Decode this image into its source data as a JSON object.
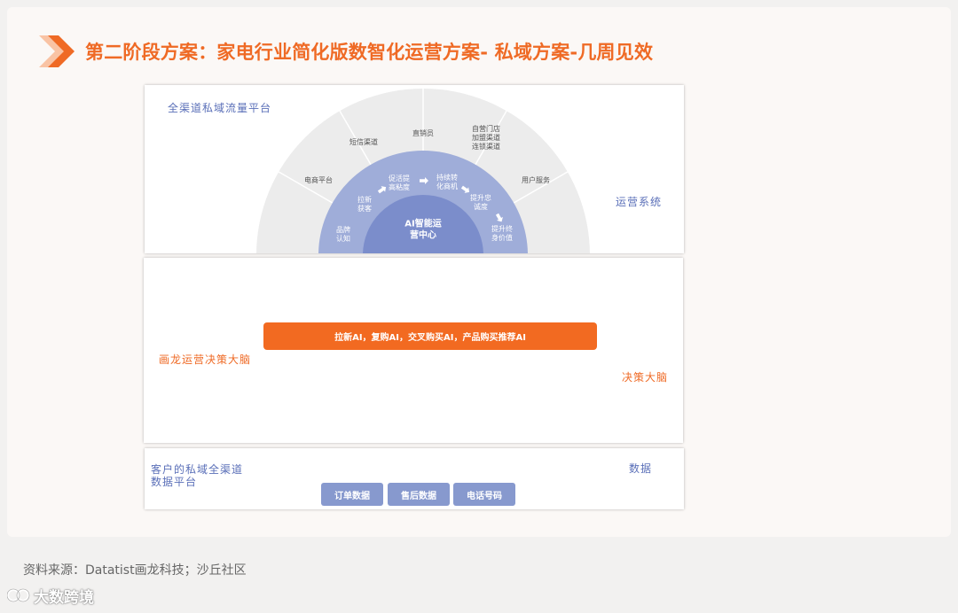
{
  "page": {
    "title": "第二阶段方案：家电行业简化版数智化运营方案- 私域方案-几周见效",
    "source": "资料来源：Datatist画龙科技；沙丘社区",
    "watermark": "大数跨境"
  },
  "top_panel": {
    "left_label": "全渠道私域流量平台",
    "right_label": "运营系统",
    "outer_segments": [
      "电商平台",
      "短信渠道",
      "直销员",
      "自营门店\n加盟渠道\n连锁渠道",
      "用户服务"
    ],
    "inner_steps": [
      "品牌\n认知",
      "拉新\n获客",
      "促活提\n高粘度",
      "持续转\n化商机",
      "提升忠\n诚度",
      "提升终\n身价值"
    ],
    "center": "AI智能运\n营中心"
  },
  "middle_panel": {
    "left_label": "画龙运营决策大脑",
    "right_label": "决策大脑",
    "bar_text": "拉新AI，复购AI，交叉购买AI，产品购买推荐AI"
  },
  "bottom_panel": {
    "left_label": "客户的私域全渠道\n数据平台",
    "right_label": "数据",
    "chips": [
      "订单数据",
      "售后数据",
      "电话号码"
    ]
  },
  "colors": {
    "accent_orange": "#ef6a25",
    "label_blue": "#5a6fb8",
    "outer_ring": "#ececec",
    "middle_ring": "#9fadd9",
    "core": "#7b8dcb",
    "chip": "#8799ce"
  }
}
